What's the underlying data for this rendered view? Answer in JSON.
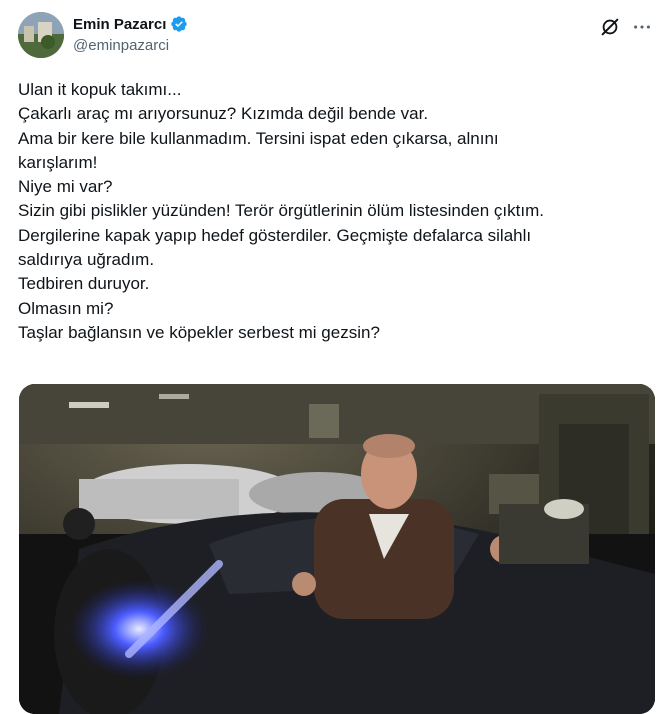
{
  "author": {
    "name": "Emin Pazarcı",
    "handle": "@eminpazarci",
    "verified": true,
    "verified_color": "#1d9bf0"
  },
  "icons": {
    "grok": "grok-icon",
    "more": "more-options-icon",
    "verified": "verified-badge-icon"
  },
  "tweet": {
    "lines": [
      "Ulan it kopuk takımı...",
      "Çakarlı araç mı arıyorsunuz? Kızımda değil bende var.",
      "Ama bir kere bile kullanmadım. Tersini ispat eden çıkarsa, alnını",
      "karışlarım!",
      "Niye mi var?",
      "Sizin gibi pislikler yüzünden! Terör örgütlerinin ölüm listesinden çıktım.",
      "Dergilerine kapak yapıp hedef gösterdiler. Geçmişte defalarca silahlı",
      "saldırıya uğradım.",
      "Tedbiren duruyor.",
      "Olmasın mi?",
      "Taşlar bağlansın ve köpekler serbest mi gezsin?"
    ]
  },
  "media": {
    "type": "video",
    "accent_light": "#3b4dff"
  }
}
